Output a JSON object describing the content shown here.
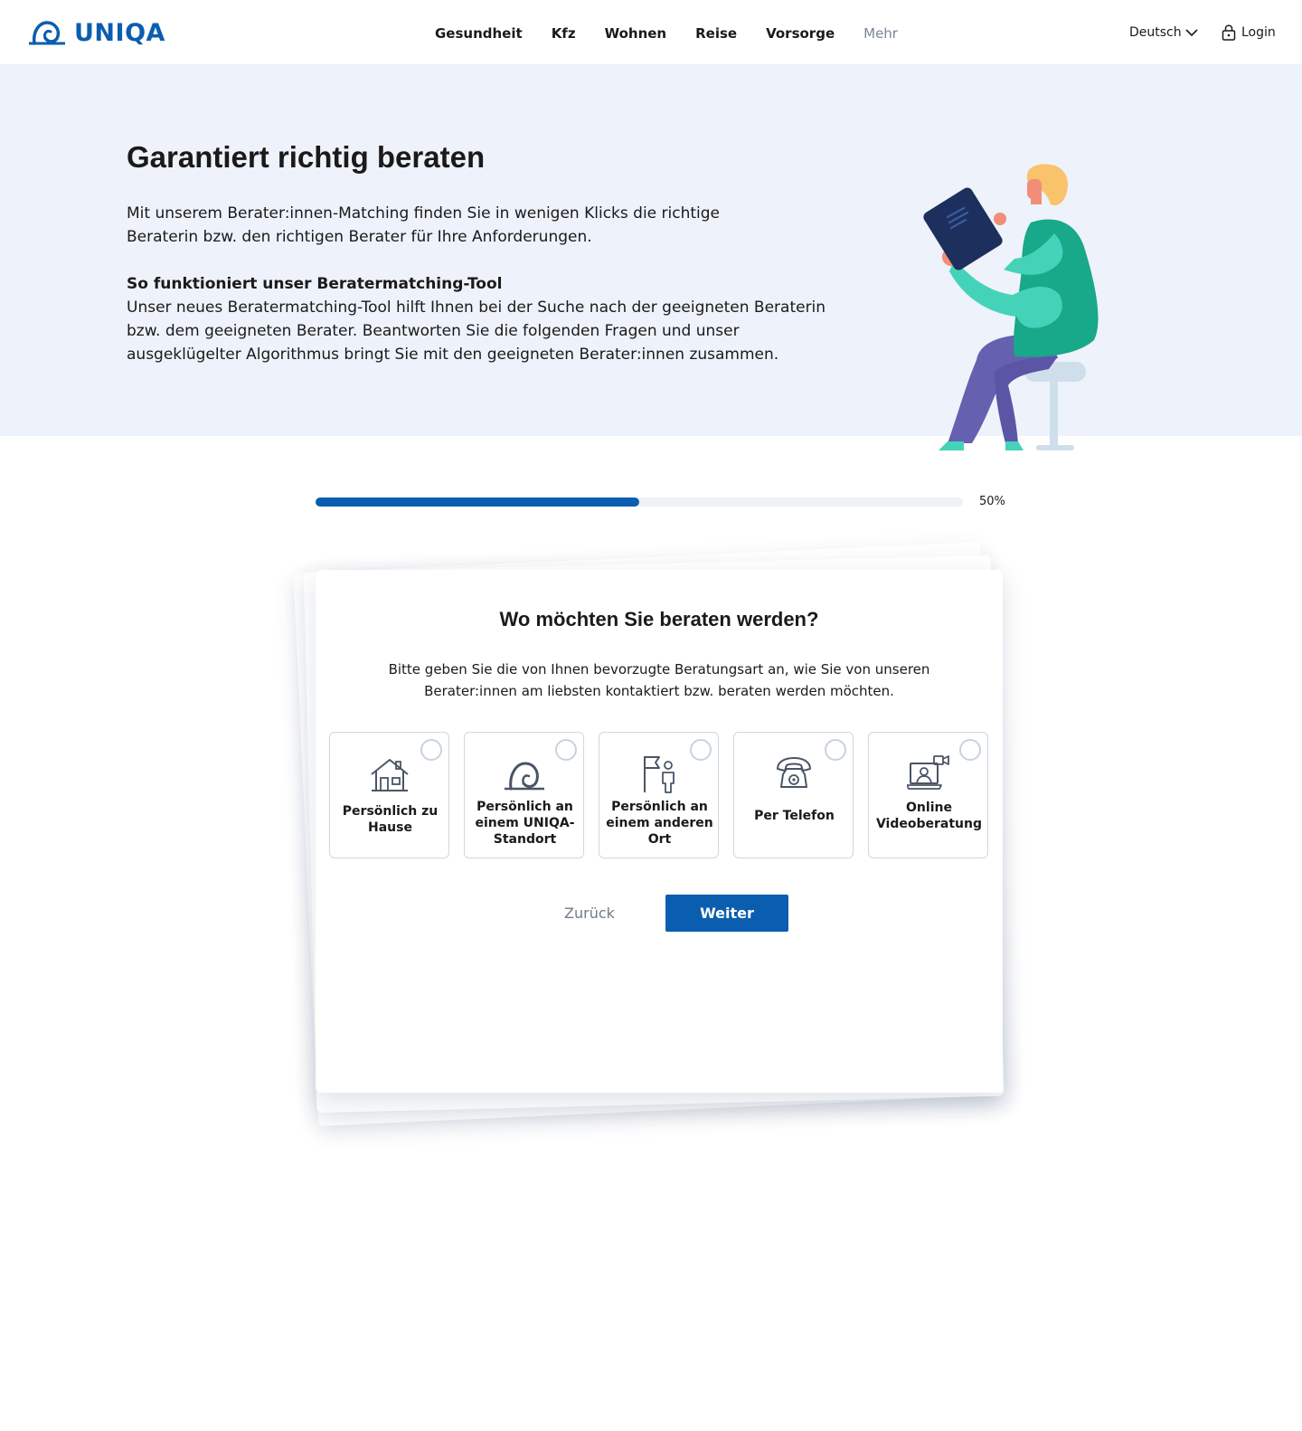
{
  "header": {
    "logo_text": "UNIQA",
    "nav": [
      "Gesundheit",
      "Kfz",
      "Wohnen",
      "Reise",
      "Vorsorge",
      "Mehr"
    ],
    "language": "Deutsch",
    "login": "Login"
  },
  "hero": {
    "title": "Garantiert richtig beraten",
    "intro": "Mit unserem Berater:innen-Matching finden Sie in wenigen Klicks die richtige Beraterin bzw. den richtigen Berater für Ihre Anforderungen.",
    "subtitle": "So funktioniert unser Beratermatching-Tool",
    "body": "Unser neues Beratermatching-Tool hilft Ihnen bei der Suche nach der geeigneten Beraterin bzw. dem geeigneten Berater. Beantworten Sie die folgenden Fragen und unser ausgeklügelter Algorithmus bringt Sie mit den geeigneten Berater:innen zusammen."
  },
  "progress": {
    "value": 0.5,
    "label": "50%"
  },
  "question": {
    "title": "Wo möchten Sie beraten werden?",
    "description": "Bitte geben Sie die von Ihnen bevorzugte Beratungsart an, wie Sie von unseren Berater:innen am liebsten kontaktiert bzw. beraten werden möchten.",
    "options": [
      {
        "label": "Persönlich zu Hause",
        "icon": "house-icon",
        "selected": false
      },
      {
        "label": "Persönlich an einem UNIQA-Standort",
        "icon": "uniqa-logo-icon",
        "selected": false
      },
      {
        "label": "Persönlich an einem anderen Ort",
        "icon": "flag-person-icon",
        "selected": false
      },
      {
        "label": "Per Telefon",
        "icon": "telephone-icon",
        "selected": false
      },
      {
        "label": "Online Videoberatung",
        "icon": "video-call-icon",
        "selected": false
      }
    ],
    "back_label": "Zurück",
    "next_label": "Weiter"
  },
  "colors": {
    "brand": "#0b5eaf",
    "hero_bg": "#eef2fa"
  }
}
